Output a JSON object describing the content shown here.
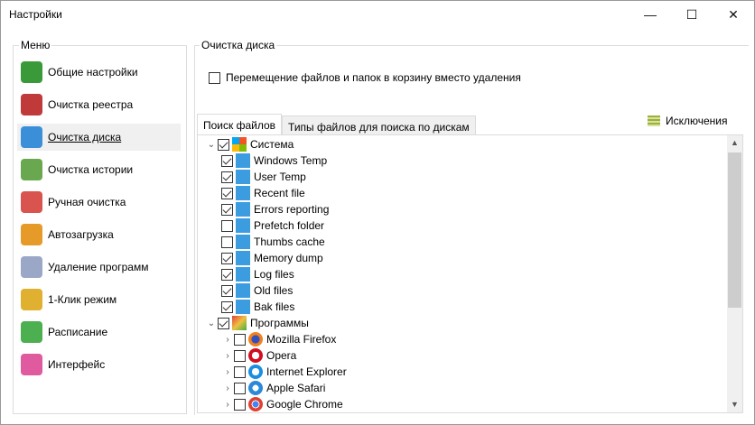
{
  "window": {
    "title": "Настройки",
    "minimize": "—",
    "maximize": "☐",
    "close": "✕"
  },
  "menu": {
    "label": "Меню",
    "items": [
      {
        "label": "Общие настройки",
        "icon": "settings-icon",
        "color": "#3a9a3a"
      },
      {
        "label": "Очистка реестра",
        "icon": "registry-icon",
        "color": "#c03a3a"
      },
      {
        "label": "Очистка диска",
        "icon": "disk-cleanup-icon",
        "color": "#3b8fd9",
        "selected": true
      },
      {
        "label": "Очистка истории",
        "icon": "history-icon",
        "color": "#6aa84f"
      },
      {
        "label": "Ручная очистка",
        "icon": "manual-clean-icon",
        "color": "#d9534f"
      },
      {
        "label": "Автозагрузка",
        "icon": "startup-icon",
        "color": "#e69a28"
      },
      {
        "label": "Удаление программ",
        "icon": "uninstall-icon",
        "color": "#9aa7c7"
      },
      {
        "label": "1-Клик режим",
        "icon": "magic-wand-icon",
        "color": "#e0b030"
      },
      {
        "label": "Расписание",
        "icon": "calendar-icon",
        "color": "#4caf50"
      },
      {
        "label": "Интерфейс",
        "icon": "interface-icon",
        "color": "#e05aa0"
      }
    ]
  },
  "main": {
    "label": "Очистка диска",
    "recycle_checkbox": {
      "label": "Перемещение файлов и папок в корзину вместо удаления",
      "checked": false
    },
    "tabs": [
      {
        "label": "Поиск файлов",
        "active": true
      },
      {
        "label": "Типы файлов для поиска по дискам",
        "active": false
      }
    ],
    "exclusions": "Исключения",
    "tree": [
      {
        "label": "Система",
        "level": 0,
        "checked": true,
        "expander": "⌄",
        "icon": "windows-icon"
      },
      {
        "label": "Windows Temp",
        "level": 1,
        "checked": true,
        "icon": "disk-cleanup-icon"
      },
      {
        "label": "User Temp",
        "level": 1,
        "checked": true,
        "icon": "disk-cleanup-icon"
      },
      {
        "label": "Recent file",
        "level": 1,
        "checked": true,
        "icon": "disk-cleanup-icon"
      },
      {
        "label": "Errors reporting",
        "level": 1,
        "checked": true,
        "icon": "disk-cleanup-icon"
      },
      {
        "label": "Prefetch folder",
        "level": 1,
        "checked": false,
        "icon": "disk-cleanup-icon"
      },
      {
        "label": "Thumbs cache",
        "level": 1,
        "checked": false,
        "icon": "disk-cleanup-icon"
      },
      {
        "label": "Memory dump",
        "level": 1,
        "checked": true,
        "icon": "disk-cleanup-icon"
      },
      {
        "label": "Log files",
        "level": 1,
        "checked": true,
        "icon": "disk-cleanup-icon"
      },
      {
        "label": "Old files",
        "level": 1,
        "checked": true,
        "icon": "disk-cleanup-icon"
      },
      {
        "label": "Bak files",
        "level": 1,
        "checked": true,
        "icon": "disk-cleanup-icon"
      },
      {
        "label": "Программы",
        "level": 0,
        "checked": true,
        "expander": "⌄",
        "icon": "programs-icon"
      },
      {
        "label": "Mozilla Firefox",
        "level": 1,
        "checked": false,
        "expander": "›",
        "icon": "firefox-icon"
      },
      {
        "label": "Opera",
        "level": 1,
        "checked": false,
        "expander": "›",
        "icon": "opera-icon"
      },
      {
        "label": "Internet Explorer",
        "level": 1,
        "checked": false,
        "expander": "›",
        "icon": "ie-icon"
      },
      {
        "label": "Apple Safari",
        "level": 1,
        "checked": false,
        "expander": "›",
        "icon": "safari-icon"
      },
      {
        "label": "Google Chrome",
        "level": 1,
        "checked": false,
        "expander": "›",
        "icon": "chrome-icon"
      }
    ]
  }
}
